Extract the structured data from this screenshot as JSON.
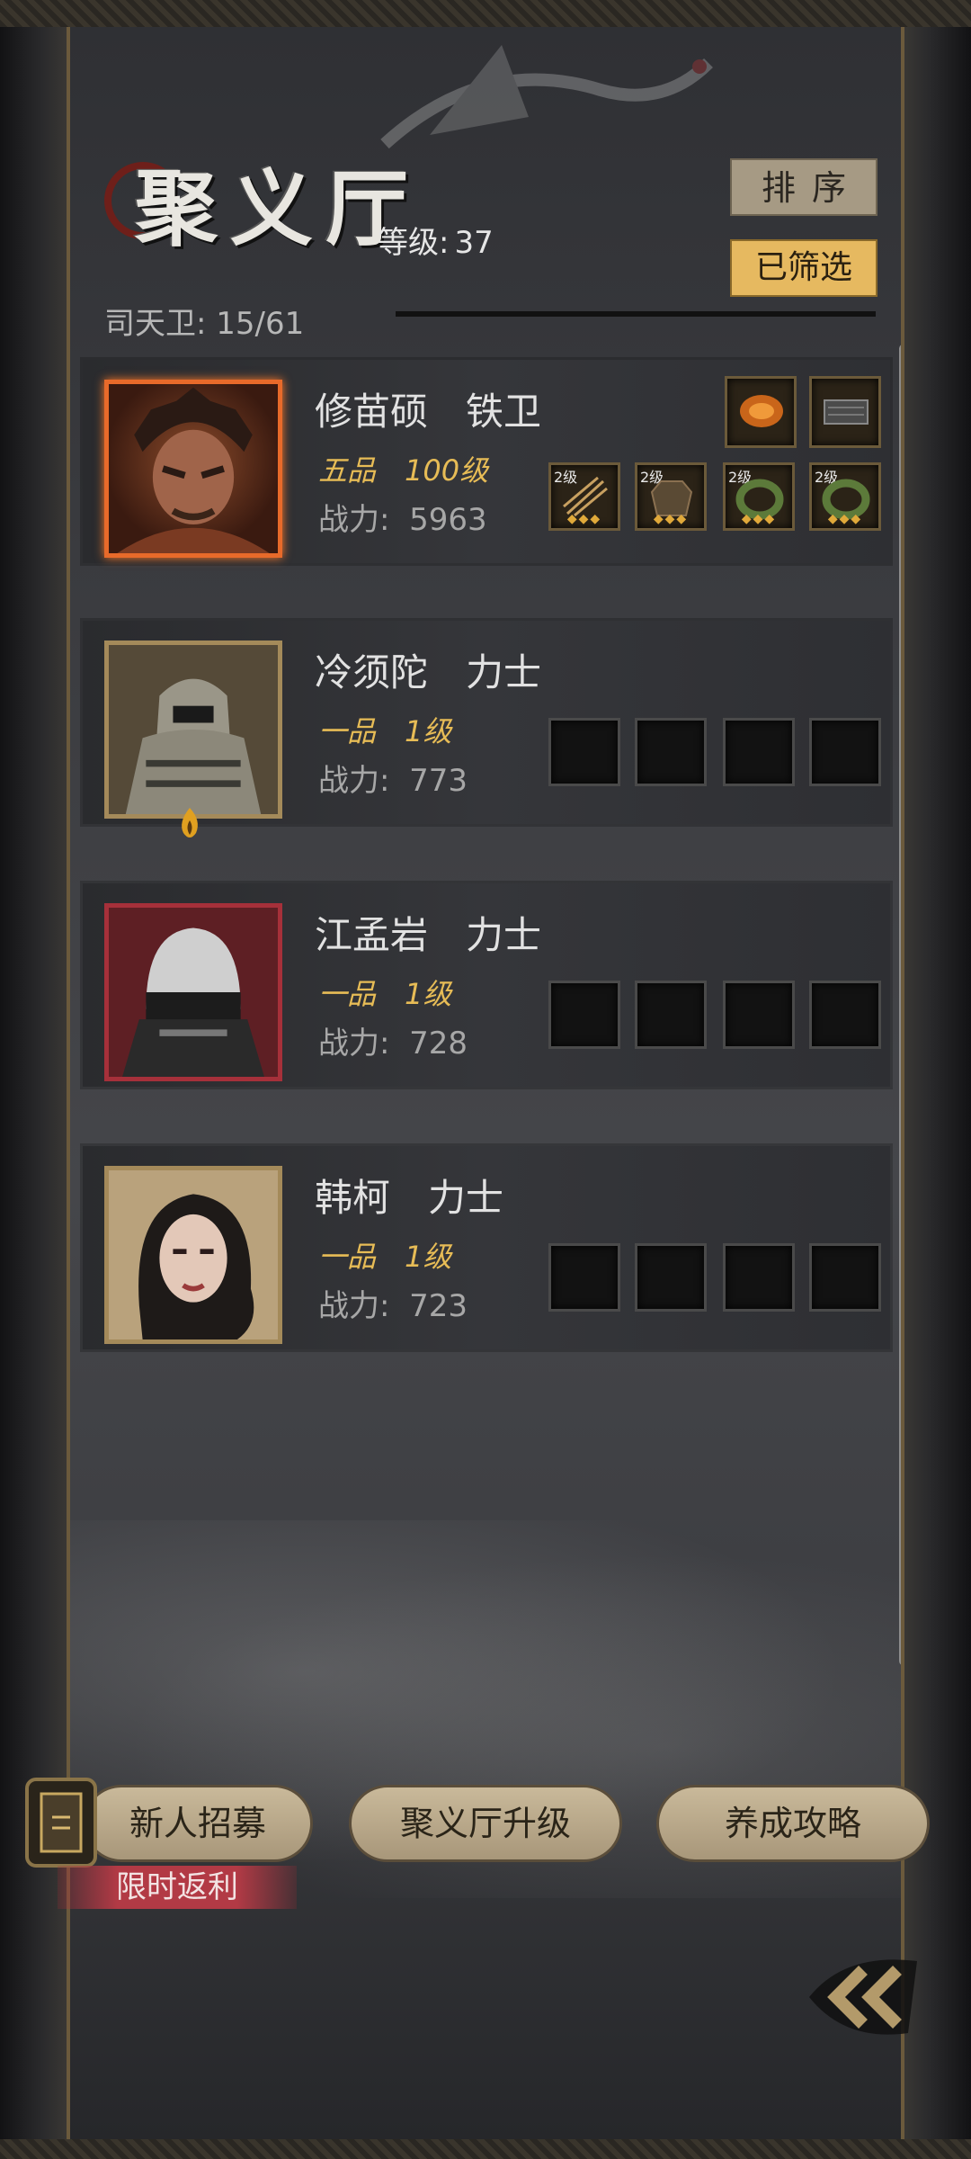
{
  "header": {
    "title": "聚义厅",
    "level_label": "等级:",
    "level_value": "37",
    "sort_label": "排序",
    "filter_label": "已筛选",
    "guard_count": "司天卫: 15/61"
  },
  "heroes": [
    {
      "name": "修苗硕　铁卫",
      "rank": "五品　100级",
      "power": "战力:  5963",
      "frame_color": "#e86a2a",
      "equipment": [
        "arrows-icon",
        "armor-icon",
        "jade-ring-icon",
        "jade-ring-icon"
      ],
      "equipment_levels": [
        "2级",
        "2级",
        "2级",
        "2级"
      ],
      "treasures": [
        "amber-disc-icon",
        "iron-box-icon"
      ]
    },
    {
      "name": "冷须陀　力士",
      "rank": "一品　1级",
      "power": "战力:  773",
      "frame_color": "#a48a5a"
    },
    {
      "name": "江孟岩　力士",
      "rank": "一品　1级",
      "power": "战力:  728",
      "frame_color": "#a6303a"
    },
    {
      "name": "韩柯　力士",
      "rank": "一品　1级",
      "power": "战力:  723",
      "frame_color": "#a48a5a"
    }
  ],
  "bottom": {
    "recruit_label": "新人招募",
    "upgrade_label": "聚义厅升级",
    "guide_label": "养成攻略",
    "promo_label": "限时返利"
  }
}
